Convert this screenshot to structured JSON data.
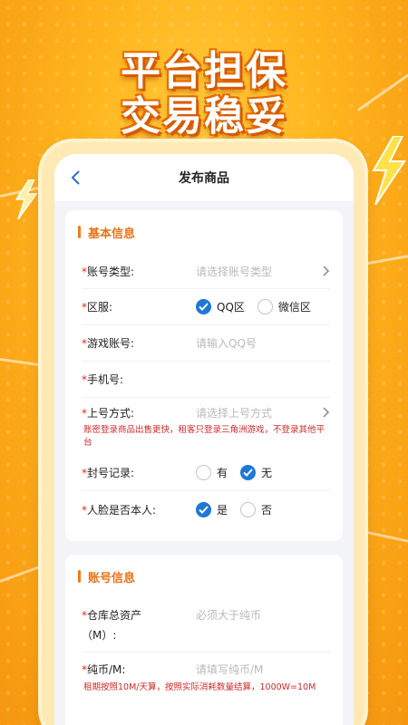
{
  "headline": {
    "line1": "平台担保",
    "line2": "交易稳妥"
  },
  "nav": {
    "title": "发布商品"
  },
  "basic": {
    "section_title": "基本信息",
    "account_type": {
      "label": "账号类型:",
      "placeholder": "请选择账号类型"
    },
    "server": {
      "label": "区服:",
      "options": [
        "QQ区",
        "微信区"
      ],
      "selected": "QQ区"
    },
    "game_account": {
      "label": "游戏账号:",
      "placeholder": "请输入QQ号"
    },
    "phone": {
      "label": "手机号:"
    },
    "login_method": {
      "label": "上号方式:",
      "placeholder": "请选择上号方式"
    },
    "login_note": "账密登录商品出售更快，租客只登录三角洲游戏，不登录其他平台",
    "ban_record": {
      "label": "封号记录:",
      "options": [
        "有",
        "无"
      ],
      "selected": "无"
    },
    "face_owner": {
      "label": "人脸是否本人:",
      "options": [
        "是",
        "否"
      ],
      "selected": "是"
    }
  },
  "account": {
    "section_title": "账号信息",
    "warehouse": {
      "label_line1": "仓库总资产",
      "label_line2": "（M）:",
      "placeholder": "必须大于纯币"
    },
    "pure_coin": {
      "label": "纯币/M:",
      "placeholder": "请填写纯币/M"
    },
    "rent_note": "租期按照10M/天算，按照实际消耗数量结算，1000W=10M"
  },
  "colors": {
    "accent": "#e8731a",
    "required": "#e02a2a",
    "checked": "#1e78d6",
    "note": "#d32a2a"
  }
}
